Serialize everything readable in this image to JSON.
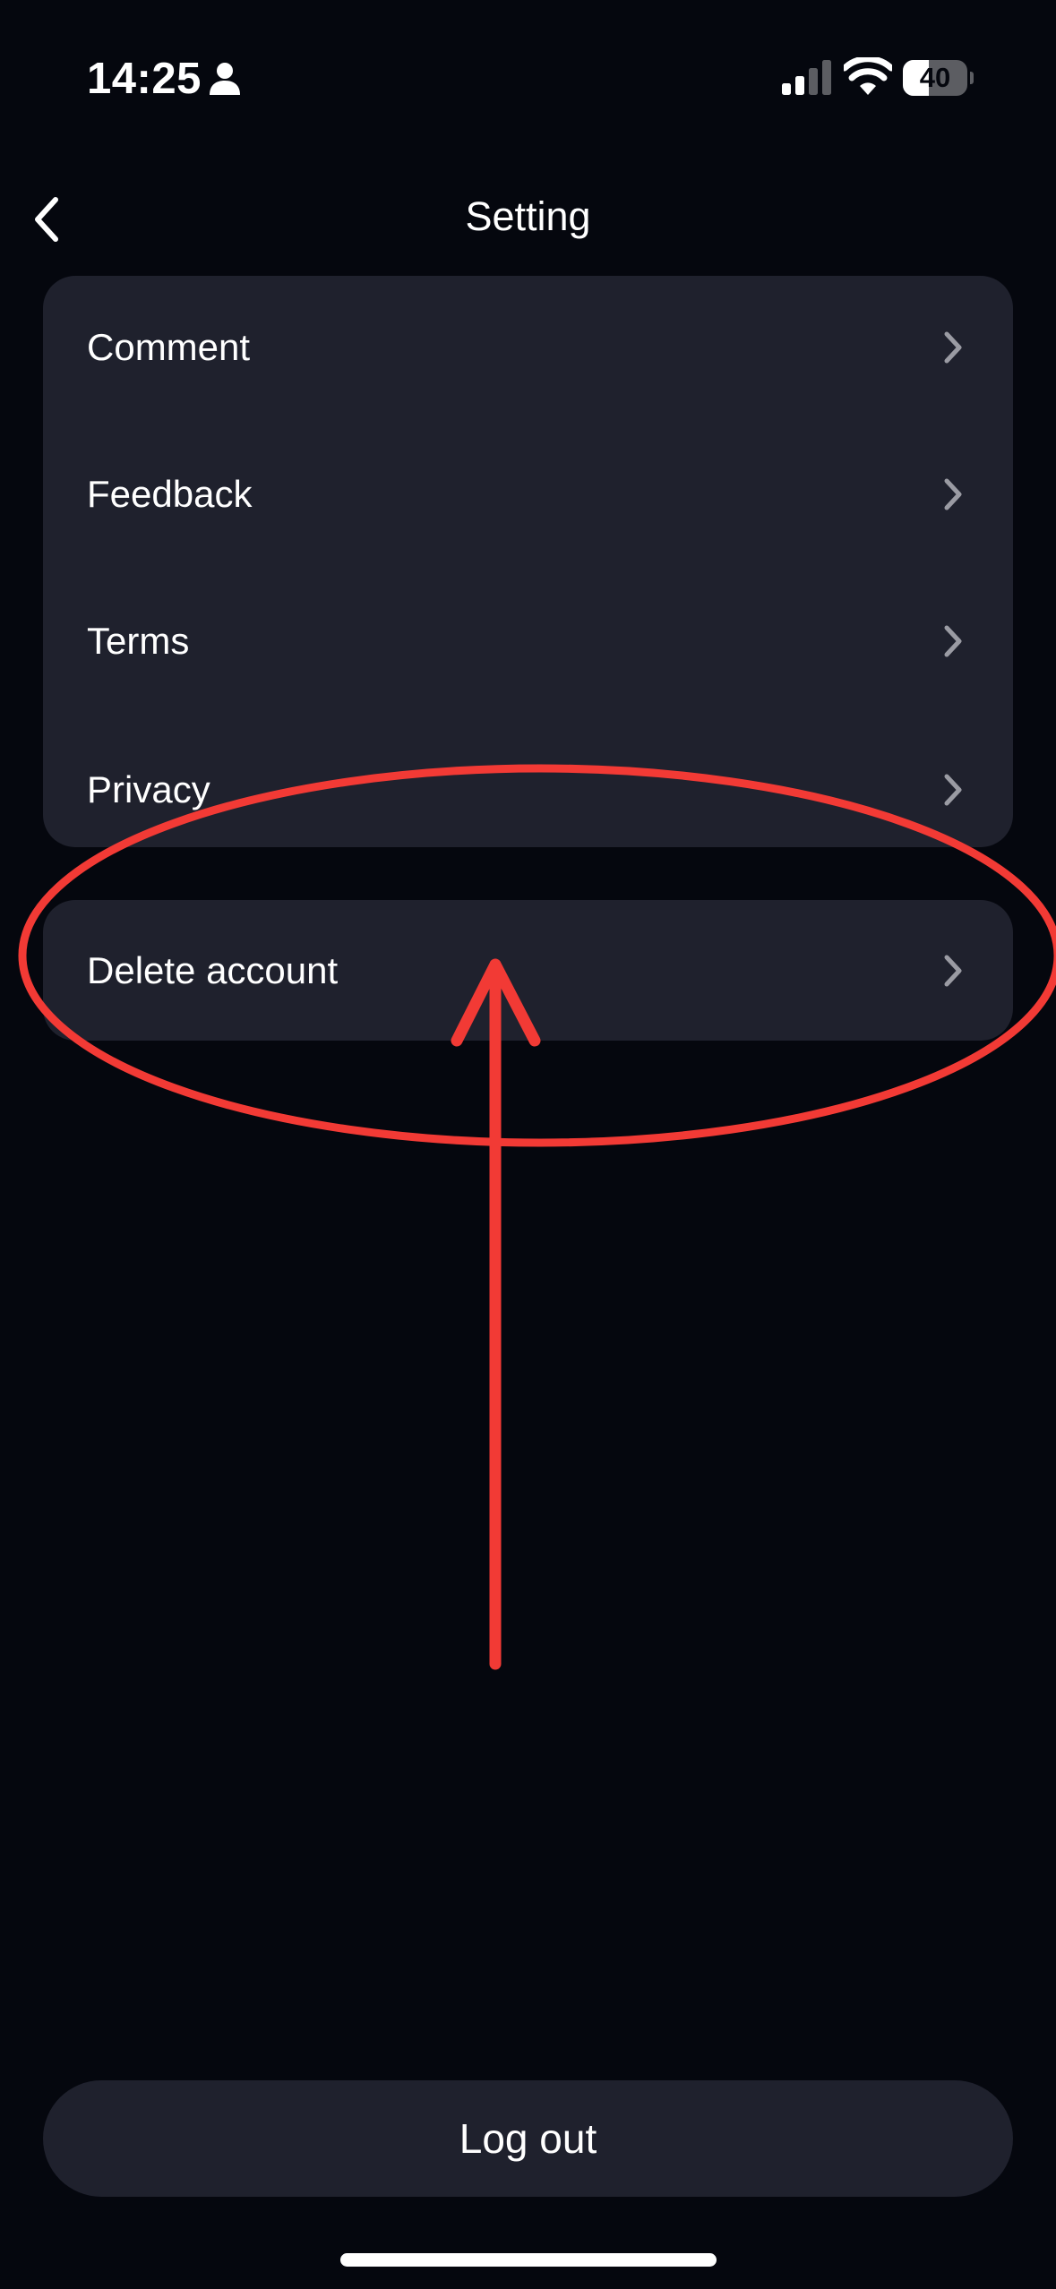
{
  "status_bar": {
    "time": "14:25",
    "battery": "40",
    "battery_level_percent": 40
  },
  "header": {
    "title": "Setting"
  },
  "settings_items": [
    {
      "label": "Comment"
    },
    {
      "label": "Feedback"
    },
    {
      "label": "Terms"
    },
    {
      "label": "Privacy"
    }
  ],
  "delete_account": {
    "label": "Delete account"
  },
  "logout": {
    "label": "Log out"
  },
  "icons": {
    "back": "chevron-left-icon",
    "row": "chevron-right-icon",
    "person": "person-icon",
    "signal": "cellular-signal-icon",
    "wifi": "wifi-icon"
  },
  "colors": {
    "background": "#05070e",
    "card": "#1f212d",
    "annotation": "#f23a35",
    "chevron": "#9a9ba3"
  }
}
